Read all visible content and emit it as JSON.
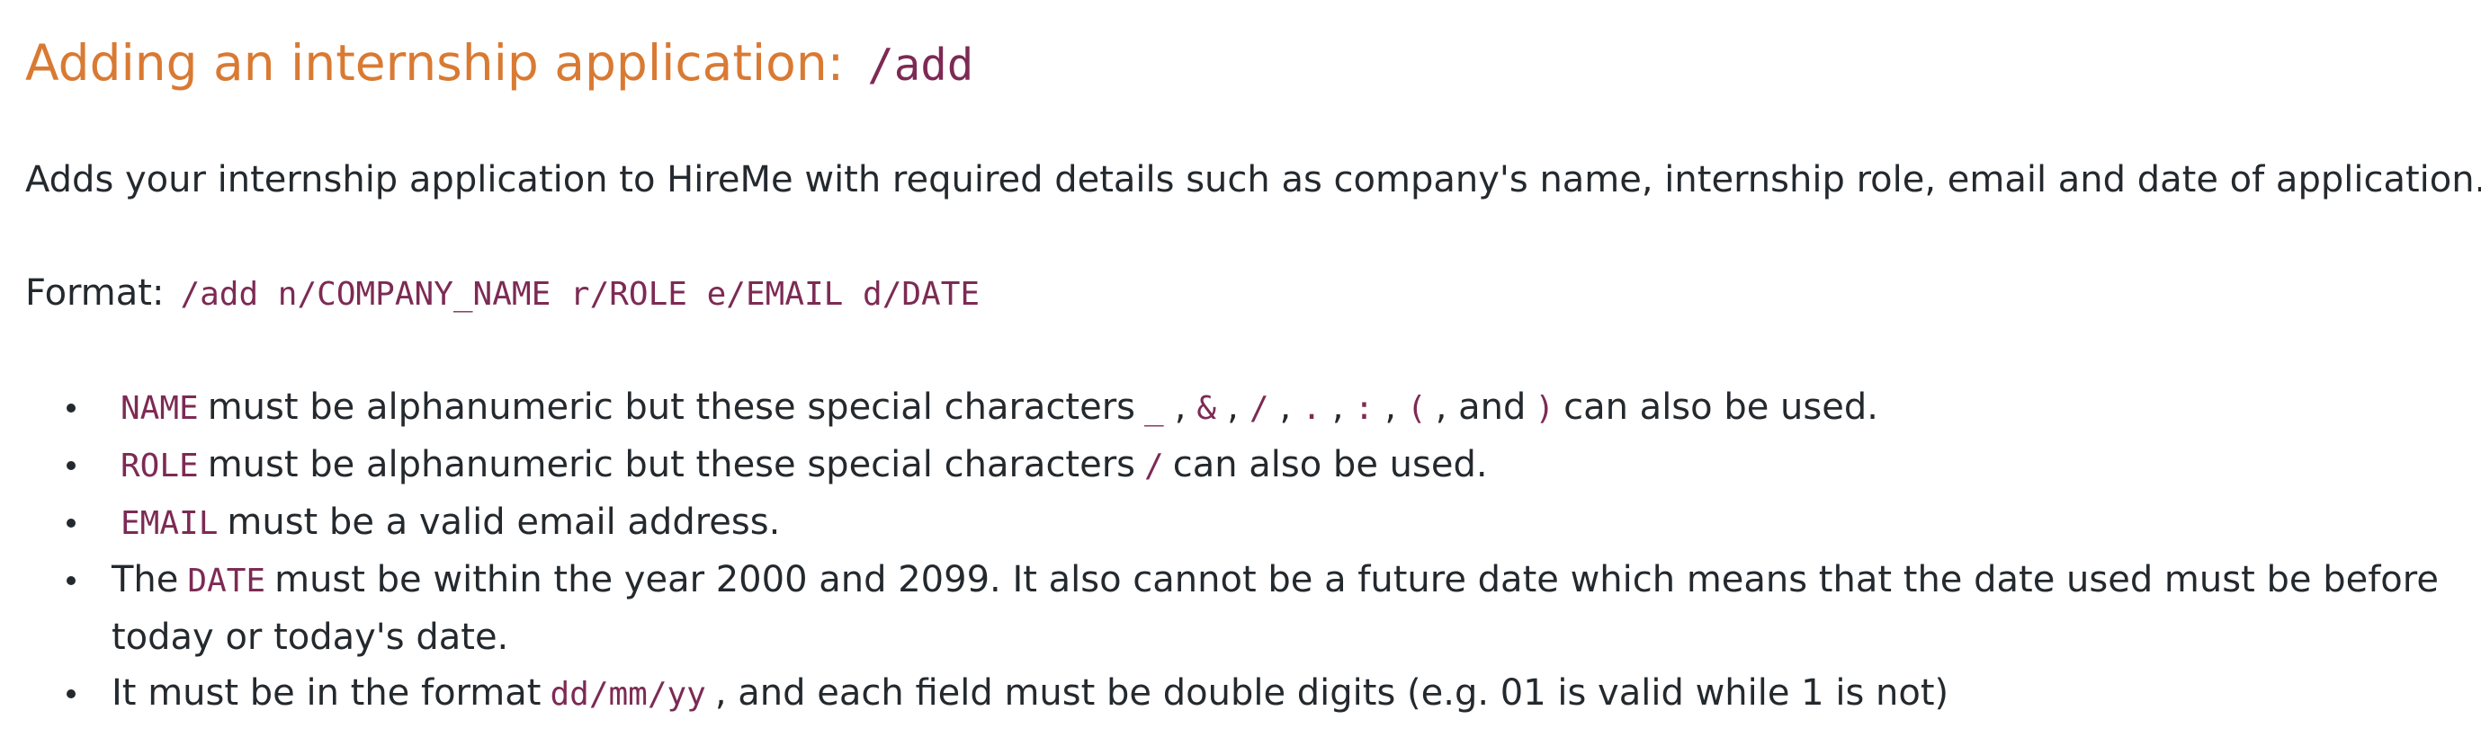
{
  "heading": {
    "title": "Adding an internship application:",
    "command": "/add"
  },
  "description": "Adds your internship application to HireMe with required details such as company's name, internship role, email and date of application.",
  "format": {
    "label": "Format:",
    "code": "/add n/COMPANY_NAME r/ROLE e/EMAIL d/DATE"
  },
  "rules": {
    "name": {
      "field": "NAME",
      "text1": "must be alphanumeric but these special characters",
      "chars": [
        "_",
        "&",
        "/",
        ".",
        ":",
        "("
      ],
      "sep": ",",
      "and_text": ", and",
      "last_char": ")",
      "text2": "can also be used."
    },
    "role": {
      "field": "ROLE",
      "text1": "must be alphanumeric but these special characters",
      "char": "/",
      "text2": "can also be used."
    },
    "email": {
      "field": "EMAIL",
      "text1": "must be a valid email address."
    },
    "date": {
      "prefix": "The",
      "field": "DATE",
      "text1": "must be within the year 2000 and 2099. It also cannot be a future date which means that the date used must be before today or today's date."
    },
    "date_format": {
      "prefix": "It must be in the format",
      "code": "dd/mm/yy",
      "text1": ", and each field must be double digits (e.g. 01 is valid while 1 is not)"
    }
  }
}
